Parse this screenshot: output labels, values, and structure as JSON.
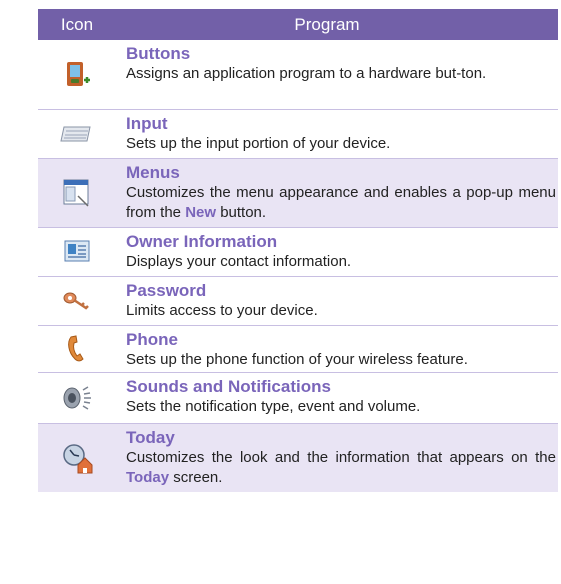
{
  "header": {
    "icon_label": "Icon",
    "program_label": "Program"
  },
  "rows": [
    {
      "icon": "buttons-icon",
      "title": "Buttons",
      "desc": "Assigns an application program to a hardware but-ton."
    },
    {
      "icon": "keyboard-icon",
      "title": "Input",
      "desc": "Sets up the input portion of your device."
    },
    {
      "icon": "menu-window-icon",
      "title": "Menus",
      "desc_a": "Customizes the menu appearance and enables a pop-up menu from the ",
      "desc_hl": "New",
      "desc_b": " button."
    },
    {
      "icon": "contact-card-icon",
      "title": "Owner Information",
      "desc": "Displays your contact information."
    },
    {
      "icon": "keys-icon",
      "title": "Password",
      "desc": "Limits access to your device."
    },
    {
      "icon": "phone-icon",
      "title": "Phone",
      "desc": "Sets up the phone function of your wireless feature."
    },
    {
      "icon": "speaker-icon",
      "title": "Sounds and Notifications",
      "desc": "Sets the notification type, event and volume."
    },
    {
      "icon": "today-home-icon",
      "title": "Today",
      "desc_a": "Customizes the look and the information that appears on the ",
      "desc_hl": "Today",
      "desc_b": " screen."
    }
  ],
  "colors": {
    "header_bg": "#7260a8",
    "title": "#7a65ba",
    "row_tint": "#e9e4f4"
  }
}
